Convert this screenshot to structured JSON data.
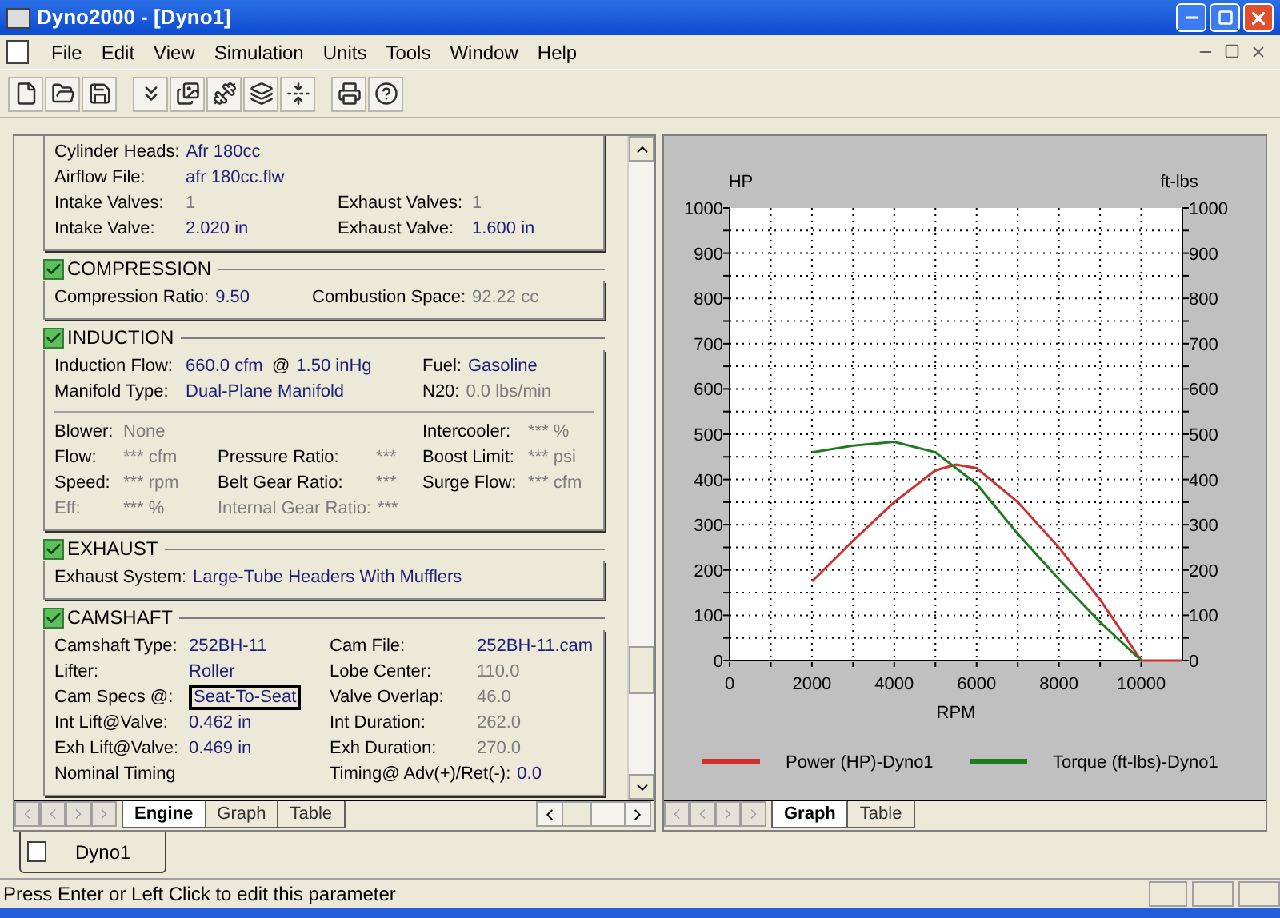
{
  "window": {
    "title": "Dyno2000 - [Dyno1]"
  },
  "menu": [
    {
      "label": "File"
    },
    {
      "label": "Edit"
    },
    {
      "label": "View"
    },
    {
      "label": "Simulation"
    },
    {
      "label": "Units"
    },
    {
      "label": "Tools"
    },
    {
      "label": "Window"
    },
    {
      "label": "Help"
    }
  ],
  "engine_panel": {
    "sections": [
      {
        "groups": [
          [
            [
              {
                "label": "Cylinder Heads:",
                "value": "Afr 180cc",
                "disabled": false
              }
            ],
            [
              {
                "label": "Airflow File:",
                "value": "afr 180cc.flw",
                "disabled": false
              }
            ],
            [
              {
                "label": "Intake Valves:",
                "value": "1",
                "disabled": true
              },
              {
                "label": "Exhaust Valves:",
                "value": "1",
                "disabled": true
              }
            ],
            [
              {
                "label": "Intake Valve:",
                "value": "2.020 in",
                "disabled": false
              },
              {
                "label": "Exhaust Valve:",
                "value": "1.600 in",
                "disabled": false
              }
            ]
          ]
        ]
      },
      {
        "title": "COMPRESSION",
        "checked": true,
        "groups": [
          [
            [
              {
                "label": "Compression Ratio:",
                "value": "9.50",
                "disabled": false
              },
              {
                "label": "Combustion Space:",
                "value": "92.22 cc",
                "disabled": true
              }
            ]
          ]
        ]
      },
      {
        "title": "INDUCTION",
        "checked": true,
        "groups": [
          [
            [
              {
                "label": "Induction Flow:",
                "value": "660.0 cfm",
                "disabled": false
              },
              {
                "label": "@",
                "value": "1.50 inHg",
                "disabled": false
              },
              {
                "label": "Fuel:",
                "value": "Gasoline",
                "disabled": false
              }
            ],
            [
              {
                "label": "Manifold Type:",
                "value": "Dual-Plane Manifold",
                "disabled": false
              },
              {
                "label": "N20:",
                "value": "0.0 lbs/min",
                "disabled": true
              }
            ]
          ],
          [
            [
              {
                "label": "Blower:",
                "value": "None",
                "disabled": true
              },
              {
                "label": "Intercooler:",
                "value": "*** %",
                "disabled": true
              }
            ],
            [
              {
                "label": "Flow:",
                "value": "*** cfm",
                "disabled": true
              },
              {
                "label": "Pressure Ratio:",
                "value": "***",
                "disabled": true
              },
              {
                "label": "Boost Limit:",
                "value": "*** psi",
                "disabled": true
              }
            ],
            [
              {
                "label": "Speed:",
                "value": "*** rpm",
                "disabled": true
              },
              {
                "label": "Belt Gear Ratio:",
                "value": "***",
                "disabled": true
              },
              {
                "label": "Surge Flow:",
                "value": "*** cfm",
                "disabled": true
              }
            ],
            [
              {
                "label": "Eff:",
                "value": "*** %",
                "disabled": true,
                "label_disabled": true
              },
              {
                "label": "Internal Gear Ratio:",
                "value": "***",
                "disabled": true,
                "label_disabled": true
              }
            ]
          ]
        ]
      },
      {
        "title": "EXHAUST",
        "checked": true,
        "groups": [
          [
            [
              {
                "label": "Exhaust System:",
                "value": "Large-Tube Headers With Mufflers",
                "disabled": false
              }
            ]
          ]
        ]
      },
      {
        "title": "CAMSHAFT",
        "checked": true,
        "groups": [
          [
            [
              {
                "label": "Camshaft Type:",
                "value": "252BH-11",
                "disabled": false
              },
              {
                "label": "Cam File:",
                "value": "252BH-11.cam",
                "disabled": false
              }
            ],
            [
              {
                "label": "Lifter:",
                "value": "Roller",
                "disabled": false
              },
              {
                "label": "Lobe Center:",
                "value": "110.0",
                "disabled": true
              }
            ],
            [
              {
                "label": "Cam Specs @:",
                "value": "Seat-To-Seat",
                "disabled": false,
                "focused": true
              },
              {
                "label": "Valve Overlap:",
                "value": "46.0",
                "disabled": true
              }
            ],
            [
              {
                "label": "Int Lift@Valve:",
                "value": "0.462 in",
                "disabled": false
              },
              {
                "label": "Int Duration:",
                "value": "262.0",
                "disabled": true
              }
            ],
            [
              {
                "label": "Exh Lift@Valve:",
                "value": "0.469 in",
                "disabled": false
              },
              {
                "label": "Exh Duration:",
                "value": "270.0",
                "disabled": true
              }
            ],
            [
              {
                "label": "Nominal Timing",
                "disabled": false
              },
              {
                "label": "Timing@ Adv(+)/Ret(-):",
                "value": "0.0",
                "disabled": false
              }
            ]
          ]
        ]
      }
    ],
    "tabs": [
      {
        "label": "Engine",
        "selected": true
      },
      {
        "label": "Graph",
        "selected": false
      },
      {
        "label": "Table",
        "selected": false
      }
    ]
  },
  "graph_panel": {
    "left_axis_ticks": [
      "1000",
      "900",
      "800",
      "700",
      "600",
      "500",
      "400",
      "300",
      "200",
      "100",
      "0"
    ],
    "right_axis_label": "ft-lbs",
    "right_axis_ticks": [
      "1000",
      "900",
      "800",
      "700",
      "600",
      "500",
      "400",
      "300",
      "200",
      "100",
      "0"
    ],
    "chart_data": {
      "type": "line",
      "grid": true,
      "legend": true,
      "xlabel": "RPM",
      "ylabel": "HP",
      "x": [
        2000,
        3000,
        4000,
        5000,
        5500,
        6000,
        7000,
        8000,
        9000,
        10000,
        11000
      ],
      "series": [
        {
          "name": "Power (HP)-Dyno1",
          "color": "#d03030",
          "values": [
            175,
            265,
            350,
            420,
            433,
            425,
            350,
            250,
            135,
            0,
            0
          ]
        },
        {
          "name": "Torque (ft-lbs)-Dyno1",
          "color": "#207a20",
          "values": [
            460,
            475,
            483,
            460,
            425,
            390,
            280,
            180,
            85,
            0,
            null
          ]
        }
      ],
      "xlim": [
        0,
        11000
      ],
      "ylim": [
        0,
        1000
      ],
      "xticks": [
        0,
        2000,
        4000,
        6000,
        8000,
        10000
      ],
      "yticks": [
        0,
        100,
        200,
        300,
        400,
        500,
        600,
        700,
        800,
        900,
        1000
      ]
    },
    "tabs": [
      {
        "label": "Graph",
        "selected": true
      },
      {
        "label": "Table",
        "selected": false
      }
    ]
  },
  "document_tabs": [
    {
      "label": "Dyno1",
      "selected": true
    }
  ],
  "status_bar": {
    "text": "Press Enter or Left Click to edit this parameter"
  }
}
